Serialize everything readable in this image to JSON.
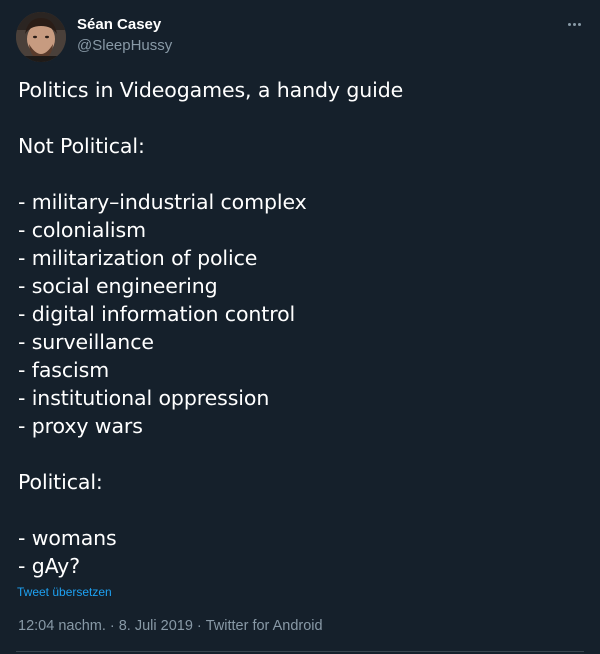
{
  "author": {
    "display_name": "Séan Casey",
    "handle": "@SleepHussy"
  },
  "tweet": {
    "title_line": "Politics in Videogames, a handy guide",
    "section_not_political": "Not Political:",
    "not_political_items": [
      "- military–industrial complex",
      "- colonialism",
      "- militarization of police",
      "- social engineering",
      "- digital information control",
      "- surveillance",
      "- fascism",
      "- institutional oppression",
      "- proxy wars"
    ],
    "section_political": "Political:",
    "political_items": [
      "- womans",
      "- gAy?"
    ]
  },
  "translate_label": "Tweet übersetzen",
  "meta": {
    "time": "12:04 nachm.",
    "separator": "·",
    "date": "8. Juli 2019",
    "source": "Twitter for Android"
  },
  "icons": {
    "more": "more-horizontal-icon"
  },
  "colors": {
    "background": "#15202b",
    "text_primary": "#ffffff",
    "text_secondary": "#8899a6",
    "link": "#1da1f2",
    "divider": "#38444d"
  }
}
